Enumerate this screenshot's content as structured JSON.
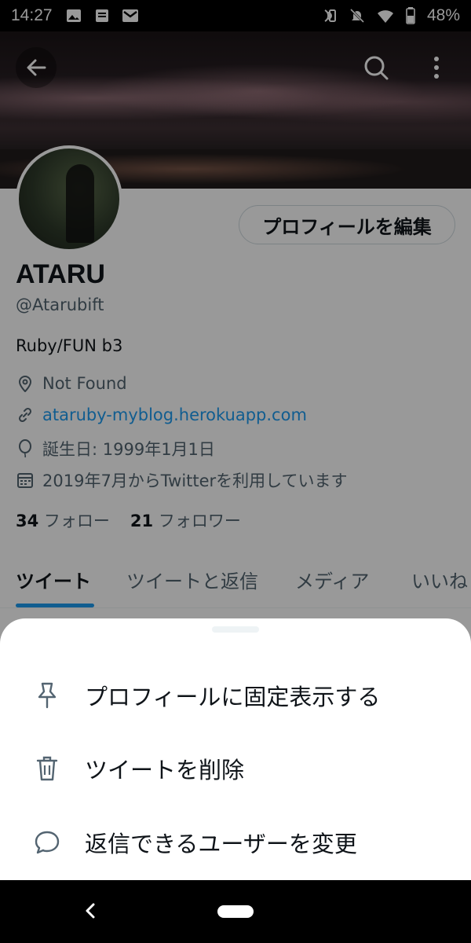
{
  "status_bar": {
    "time": "14:27",
    "battery": "48%"
  },
  "profile": {
    "name": "ATARU",
    "handle": "@Atarubift",
    "bio": "Ruby/FUN b3",
    "location": "Not Found",
    "url": "ataruby-myblog.herokuapp.com",
    "birthday": "誕生日: 1999年1月1日",
    "joined": "2019年7月からTwitterを利用しています",
    "following_count": "34",
    "following_label": "フォロー",
    "followers_count": "21",
    "followers_label": "フォロワー",
    "edit_button": "プロフィールを編集"
  },
  "tabs": [
    "ツイート",
    "ツイートと返信",
    "メディア",
    "いいね"
  ],
  "sheet": {
    "items": [
      {
        "label": "プロフィールに固定表示する",
        "icon": "pin-icon"
      },
      {
        "label": "ツイートを削除",
        "icon": "trash-icon"
      },
      {
        "label": "返信できるユーザーを変更",
        "icon": "speech-bubble-icon"
      }
    ]
  },
  "colors": {
    "accent": "#1d9bf0",
    "text": "#0f1419",
    "secondary": "#536471"
  }
}
